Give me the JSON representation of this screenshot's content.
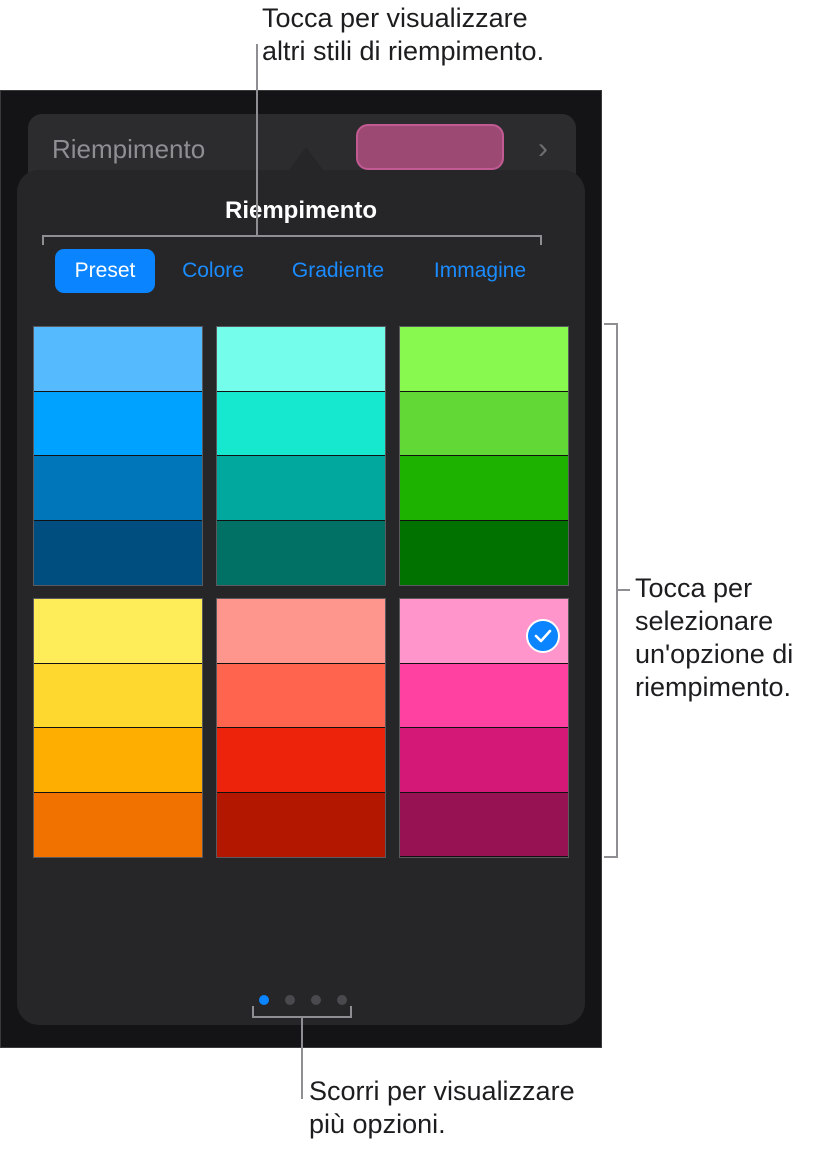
{
  "callouts": {
    "top": "Tocca per visualizzare\naltri stili di riempimento.",
    "right": "Tocca per\nselezionare\nun'opzione di\nriempimento.",
    "bottom": "Scorri per visualizzare\npiù opzioni."
  },
  "fill_row": {
    "label": "Riempimento",
    "current_color": "#9c4a74"
  },
  "popover": {
    "title": "Riempimento",
    "tabs": [
      {
        "label": "Preset",
        "active": true
      },
      {
        "label": "Colore",
        "active": false
      },
      {
        "label": "Gradiente",
        "active": false
      },
      {
        "label": "Immagine",
        "active": false
      }
    ],
    "swatches": [
      {
        "name": "blue",
        "colors": [
          "#56bbfe",
          "#00a2ff",
          "#0076ba",
          "#004d7f"
        ],
        "selected": false
      },
      {
        "name": "teal",
        "colors": [
          "#73fdea",
          "#16e7cf",
          "#00a89d",
          "#017165"
        ],
        "selected": false
      },
      {
        "name": "green",
        "colors": [
          "#88fa4f",
          "#61d836",
          "#1db100",
          "#017100"
        ],
        "selected": false
      },
      {
        "name": "yellow",
        "colors": [
          "#ffec59",
          "#fed82f",
          "#feae00",
          "#f27200"
        ],
        "selected": false
      },
      {
        "name": "red",
        "colors": [
          "#ff968d",
          "#ff644e",
          "#ee230c",
          "#b41700"
        ],
        "selected": false
      },
      {
        "name": "pink",
        "colors": [
          "#ff95ca",
          "#ff42a1",
          "#d41877",
          "#971253"
        ],
        "selected": true
      }
    ],
    "page_dots": {
      "count": 4,
      "active_index": 0
    }
  },
  "colors": {
    "accent": "#0a84ff",
    "background": "#141416",
    "panel": "#262628"
  }
}
